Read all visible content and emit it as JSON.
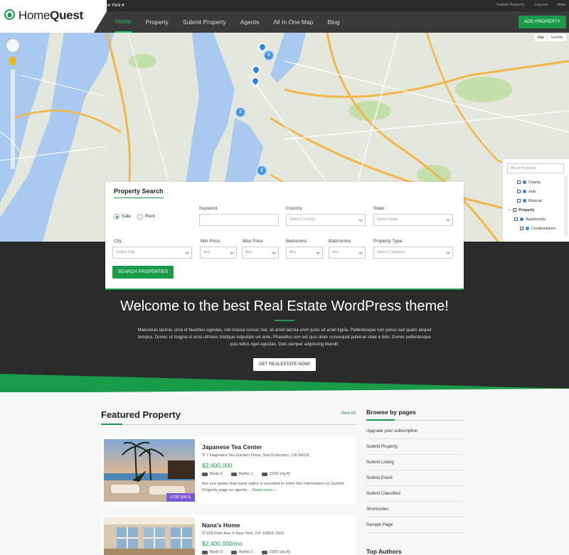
{
  "topbar": {
    "city": "New York",
    "links": [
      "Submit Property",
      "Log out",
      "Allen"
    ]
  },
  "brand": {
    "name_light": "Home",
    "name_bold": "Quest"
  },
  "nav": {
    "items": [
      "Home",
      "Property",
      "Submit Property",
      "Agents",
      "All In One Map",
      "Blog"
    ],
    "active": "Home",
    "add_property": "ADD PROPERTY"
  },
  "map": {
    "map_types": [
      "Map",
      "Satellite"
    ],
    "filter_placeholder": "Title or Keyword",
    "filter_items": [
      "Charity",
      "club",
      "Musical",
      "Property",
      "Apartments",
      "Condominium"
    ],
    "clusters": [
      "5",
      "2",
      "2"
    ]
  },
  "search": {
    "title": "Property Search",
    "radio_sale": "Sale",
    "radio_rent": "Rent",
    "keyword_label": "Keyword",
    "country_label": "Country",
    "country_value": "Select Country",
    "state_label": "State",
    "state_value": "Select State",
    "city_label": "City",
    "city_value": "Select City",
    "minprice_label": "Min Price",
    "minprice_value": "Any",
    "maxprice_label": "Max Price",
    "maxprice_value": "Any",
    "bedrooms_label": "Bedrooms",
    "bedrooms_value": "Any",
    "bathrooms_label": "Bathrooms",
    "bathrooms_value": "Any",
    "type_label": "Property Type",
    "type_value": "Select Category",
    "button": "SEARCH PROPERTIES"
  },
  "hero": {
    "title": "Welcome to the best Real Estate WordPress theme!",
    "text": "Maecenas lacinia, urna id faucibus egestas, nisl massa cursus nisl, sit amet lacinia enim justo sit amet ligula. Pellentesque non purus sed quam aliquet tempus. Donec ut magna ut urna ultricies tristique vulputate vel ante. Phasellus non est quis dolor consequat pulvinar vitae a felis. Donec pellentesque quis tellus eget egestas. Duis semper adipiscing blandit.",
    "button": "GET REALESTATE NOW!"
  },
  "featured": {
    "title": "Featured Property",
    "view_all": "View All",
    "cards": [
      {
        "name": "Japanese Tea Center",
        "address": "7 Hagiwara Tea Garden Drive, San Francisco, CA 94118",
        "price": "$2,400,000",
        "beds": "Beds 5",
        "baths": "Baths 1",
        "area": "2200 (sq.ft)",
        "desc": "Are you aware that basic editor is provided to enter this information on Submit Property page so agents…",
        "more": "Read more »",
        "badge": "FOR SALE"
      },
      {
        "name": "Nana's Home",
        "address": "228 Park Ave S New York, NY 10003-1502",
        "price": "$2,400,000/mo",
        "beds": "Beds 5",
        "baths": "Baths 1",
        "area": "2200 (sq.ft)"
      }
    ]
  },
  "sidebar": {
    "title": "Browse by pages",
    "items": [
      "Upgrade your subscription",
      "Submit Property",
      "Submit Listing",
      "Submit Event",
      "Submit Classified",
      "Shortcodes",
      "Sample Page"
    ],
    "title2": "Top Authors"
  },
  "colors": {
    "accent": "#1a9b4a",
    "dark": "#2b2b2b",
    "badge": "#7b5ad6",
    "pin": "#2a86e0"
  }
}
